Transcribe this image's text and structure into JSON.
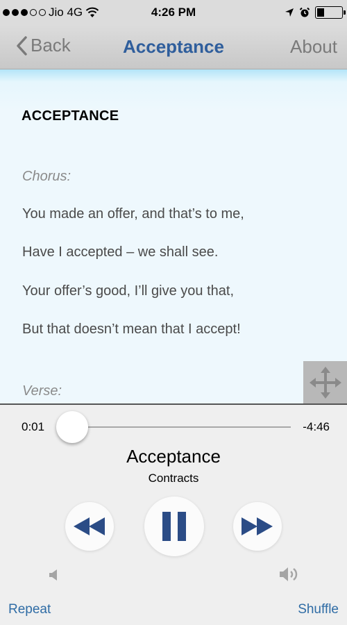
{
  "status_bar": {
    "carrier": "Jio 4G",
    "time": "4:26 PM"
  },
  "nav": {
    "back_label": "Back",
    "title": "Acceptance",
    "about_label": "About"
  },
  "lyrics": {
    "heading": "ACCEPTANCE",
    "chorus_label": "Chorus:",
    "lines": [
      "You made an offer, and that’s to me,",
      "Have I accepted – we shall see.",
      "Your offer’s good, I’ll give you that,",
      "But that doesn’t mean that I accept!"
    ],
    "verse_label": "Verse:"
  },
  "player": {
    "elapsed": "0:01",
    "remaining": "-4:46",
    "progress_fraction": 0.004,
    "title": "Acceptance",
    "album": "Contracts",
    "repeat_label": "Repeat",
    "shuffle_label": "Shuffle"
  },
  "colors": {
    "accent": "#2f5e9c",
    "link": "#2f6ca5",
    "lyrics_bg": "#eef8fd"
  }
}
